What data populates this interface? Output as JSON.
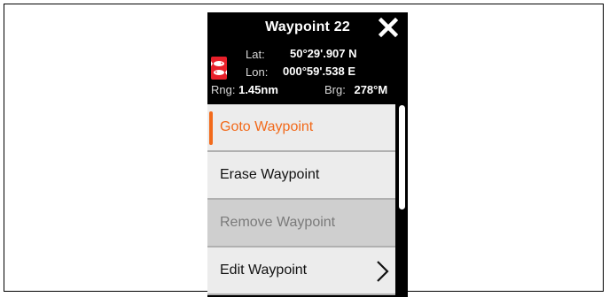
{
  "window": {
    "title": "Waypoint 22"
  },
  "waypoint": {
    "lat_label": "Lat:",
    "lat_value": "50°29'.907 N",
    "lon_label": "Lon:",
    "lon_value": "000°59'.538 E",
    "rng_label": "Rng:",
    "rng_value": "1.45nm",
    "brg_label": "Brg:",
    "brg_value": "278°M"
  },
  "menu": {
    "items": [
      {
        "label": "Goto Waypoint",
        "state": "selected"
      },
      {
        "label": "Erase Waypoint",
        "state": "normal"
      },
      {
        "label": "Remove Waypoint",
        "state": "disabled"
      },
      {
        "label": "Edit Waypoint",
        "state": "normal",
        "has_submenu": true
      }
    ]
  },
  "colors": {
    "accent": "#f26a1b",
    "panel_bg": "#000000",
    "menu_bg": "#ececec",
    "disabled_bg": "#cfcfcf",
    "waypoint_icon": "#e8202a"
  },
  "icons": {
    "close": "close-icon",
    "waypoint": "waypoint-fish-icon",
    "submenu": "chevron-right-icon"
  }
}
